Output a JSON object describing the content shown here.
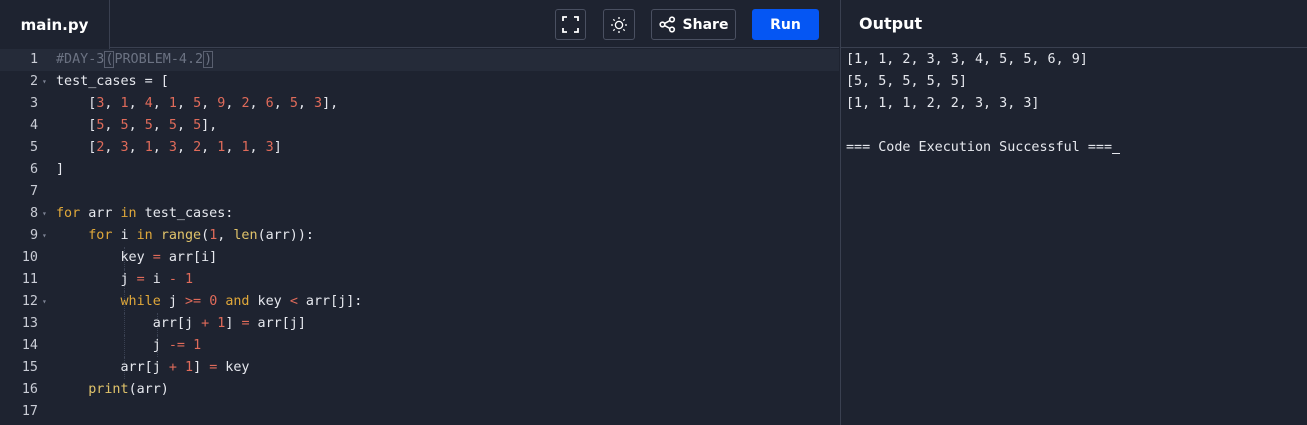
{
  "editor": {
    "file_tab": "main.py",
    "share_label": "Share",
    "run_label": "Run",
    "icons": {
      "fullscreen": "fullscreen-icon",
      "theme": "sun-icon",
      "share": "share-icon"
    }
  },
  "output": {
    "title": "Output",
    "lines": [
      "[1, 1, 2, 3, 3, 4, 5, 5, 6, 9]",
      "[5, 5, 5, 5, 5]",
      "[1, 1, 1, 2, 2, 3, 3, 3]",
      "",
      "=== Code Execution Successful ==="
    ]
  },
  "code": {
    "lines": [
      {
        "n": "1",
        "fold": false,
        "active": true,
        "tokens": [
          [
            "com",
            "#DAY-3"
          ],
          [
            "comb",
            "(PROBLEM-4.2)"
          ]
        ]
      },
      {
        "n": "2",
        "fold": true,
        "tokens": [
          [
            "txt",
            "test_cases = ["
          ]
        ]
      },
      {
        "n": "3",
        "fold": false,
        "tokens": [
          [
            "txt",
            "    ["
          ],
          [
            "num",
            "3"
          ],
          [
            "txt",
            ", "
          ],
          [
            "num",
            "1"
          ],
          [
            "txt",
            ", "
          ],
          [
            "num",
            "4"
          ],
          [
            "txt",
            ", "
          ],
          [
            "num",
            "1"
          ],
          [
            "txt",
            ", "
          ],
          [
            "num",
            "5"
          ],
          [
            "txt",
            ", "
          ],
          [
            "num",
            "9"
          ],
          [
            "txt",
            ", "
          ],
          [
            "num",
            "2"
          ],
          [
            "txt",
            ", "
          ],
          [
            "num",
            "6"
          ],
          [
            "txt",
            ", "
          ],
          [
            "num",
            "5"
          ],
          [
            "txt",
            ", "
          ],
          [
            "num",
            "3"
          ],
          [
            "txt",
            "],"
          ]
        ]
      },
      {
        "n": "4",
        "fold": false,
        "tokens": [
          [
            "txt",
            "    ["
          ],
          [
            "num",
            "5"
          ],
          [
            "txt",
            ", "
          ],
          [
            "num",
            "5"
          ],
          [
            "txt",
            ", "
          ],
          [
            "num",
            "5"
          ],
          [
            "txt",
            ", "
          ],
          [
            "num",
            "5"
          ],
          [
            "txt",
            ", "
          ],
          [
            "num",
            "5"
          ],
          [
            "txt",
            "],"
          ]
        ]
      },
      {
        "n": "5",
        "fold": false,
        "tokens": [
          [
            "txt",
            "    ["
          ],
          [
            "num",
            "2"
          ],
          [
            "txt",
            ", "
          ],
          [
            "num",
            "3"
          ],
          [
            "txt",
            ", "
          ],
          [
            "num",
            "1"
          ],
          [
            "txt",
            ", "
          ],
          [
            "num",
            "3"
          ],
          [
            "txt",
            ", "
          ],
          [
            "num",
            "2"
          ],
          [
            "txt",
            ", "
          ],
          [
            "num",
            "1"
          ],
          [
            "txt",
            ", "
          ],
          [
            "num",
            "1"
          ],
          [
            "txt",
            ", "
          ],
          [
            "num",
            "3"
          ],
          [
            "txt",
            "]"
          ]
        ]
      },
      {
        "n": "6",
        "fold": false,
        "tokens": [
          [
            "txt",
            "]"
          ]
        ]
      },
      {
        "n": "7",
        "fold": false,
        "tokens": []
      },
      {
        "n": "8",
        "fold": true,
        "tokens": [
          [
            "kw",
            "for"
          ],
          [
            "txt",
            " arr "
          ],
          [
            "kw",
            "in"
          ],
          [
            "txt",
            " test_cases:"
          ]
        ]
      },
      {
        "n": "9",
        "fold": true,
        "tokens": [
          [
            "txt",
            "    "
          ],
          [
            "kw",
            "for"
          ],
          [
            "txt",
            " i "
          ],
          [
            "kw",
            "in"
          ],
          [
            "txt",
            " "
          ],
          [
            "fn",
            "range"
          ],
          [
            "txt",
            "("
          ],
          [
            "num",
            "1"
          ],
          [
            "txt",
            ", "
          ],
          [
            "fn",
            "len"
          ],
          [
            "txt",
            "(arr)):"
          ]
        ]
      },
      {
        "n": "10",
        "fold": false,
        "tokens": [
          [
            "txt",
            "        key "
          ],
          [
            "op",
            "="
          ],
          [
            "txt",
            " arr[i]"
          ]
        ]
      },
      {
        "n": "11",
        "fold": false,
        "tokens": [
          [
            "txt",
            "        j "
          ],
          [
            "op",
            "="
          ],
          [
            "txt",
            " i "
          ],
          [
            "op",
            "-"
          ],
          [
            "txt",
            " "
          ],
          [
            "num",
            "1"
          ]
        ]
      },
      {
        "n": "12",
        "fold": true,
        "tokens": [
          [
            "txt",
            "        "
          ],
          [
            "kw",
            "while"
          ],
          [
            "txt",
            " j "
          ],
          [
            "op",
            ">="
          ],
          [
            "txt",
            " "
          ],
          [
            "num",
            "0"
          ],
          [
            "txt",
            " "
          ],
          [
            "kw",
            "and"
          ],
          [
            "txt",
            " key "
          ],
          [
            "op",
            "<"
          ],
          [
            "txt",
            " arr[j]:"
          ]
        ]
      },
      {
        "n": "13",
        "fold": false,
        "tokens": [
          [
            "txt",
            "            arr[j "
          ],
          [
            "op",
            "+"
          ],
          [
            "txt",
            " "
          ],
          [
            "num",
            "1"
          ],
          [
            "txt",
            "] "
          ],
          [
            "op",
            "="
          ],
          [
            "txt",
            " arr[j]"
          ]
        ]
      },
      {
        "n": "14",
        "fold": false,
        "tokens": [
          [
            "txt",
            "            j "
          ],
          [
            "op",
            "-="
          ],
          [
            "txt",
            " "
          ],
          [
            "num",
            "1"
          ]
        ]
      },
      {
        "n": "15",
        "fold": false,
        "tokens": [
          [
            "txt",
            "        arr[j "
          ],
          [
            "op",
            "+"
          ],
          [
            "txt",
            " "
          ],
          [
            "num",
            "1"
          ],
          [
            "txt",
            "] "
          ],
          [
            "op",
            "="
          ],
          [
            "txt",
            " key"
          ]
        ]
      },
      {
        "n": "16",
        "fold": false,
        "tokens": [
          [
            "txt",
            "    "
          ],
          [
            "fn",
            "print"
          ],
          [
            "txt",
            "(arr)"
          ]
        ]
      },
      {
        "n": "17",
        "fold": false,
        "tokens": []
      }
    ]
  },
  "colors": {
    "background": "#1e2330",
    "run_button": "#0556f3",
    "keyword": "#e0a83a",
    "number": "#e06b5a",
    "comment": "#6b7282"
  }
}
